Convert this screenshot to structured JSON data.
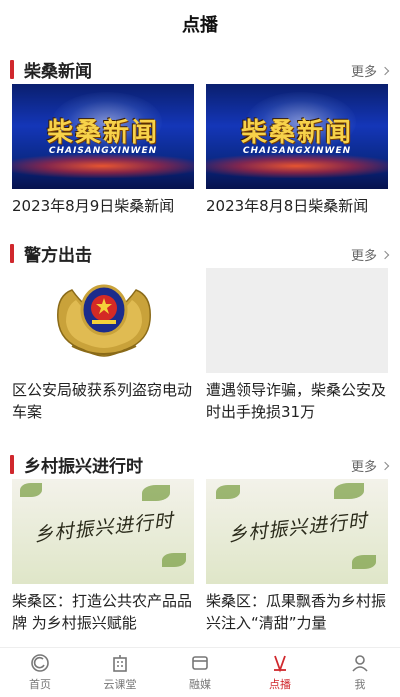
{
  "header": {
    "title": "点播"
  },
  "sections": [
    {
      "title": "柴桑新闻",
      "more": "更多",
      "items": [
        {
          "caption": "2023年8月9日柴桑新闻",
          "logo_cn": "柴桑新闻",
          "logo_en": "CHAISANGXINWEN"
        },
        {
          "caption": "2023年8月8日柴桑新闻",
          "logo_cn": "柴桑新闻",
          "logo_en": "CHAISANGXINWEN"
        }
      ]
    },
    {
      "title": "警方出击",
      "more": "更多",
      "items": [
        {
          "caption": "区公安局破获系列盗窃电动车案"
        },
        {
          "caption": "遭遇领导诈骗，柴桑公安及时出手挽损31万"
        }
      ]
    },
    {
      "title": "乡村振兴进行时",
      "more": "更多",
      "items": [
        {
          "caption": "柴桑区：打造公共农产品品牌 为乡村振兴赋能",
          "logo": "乡村振兴进行时"
        },
        {
          "caption": "柴桑区：瓜果飘香为乡村振兴注入“清甜”力量",
          "logo": "乡村振兴进行时"
        }
      ]
    }
  ],
  "tabbar": {
    "active": "点播",
    "tabs": [
      {
        "label": "首页",
        "icon": "home-icon"
      },
      {
        "label": "云课堂",
        "icon": "building-icon"
      },
      {
        "label": "融媒",
        "icon": "media-icon"
      },
      {
        "label": "点播",
        "icon": "play-icon"
      },
      {
        "label": "我",
        "icon": "user-icon"
      }
    ]
  },
  "colors": {
    "accent": "#d0282d",
    "text": "#222222",
    "muted": "#777777"
  }
}
